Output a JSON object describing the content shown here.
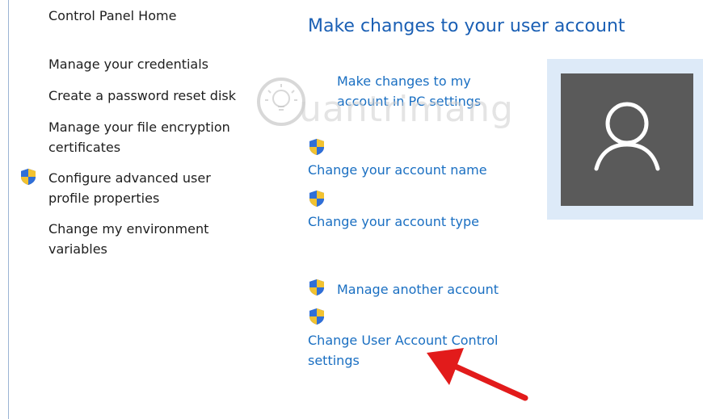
{
  "left_panel": {
    "home": "Control Panel Home",
    "tasks": [
      "Manage your credentials",
      "Create a password reset disk",
      "Manage your file encryption certificates",
      "Configure advanced user profile properties",
      "Change my environment variables"
    ]
  },
  "main": {
    "title": "Make changes to your user account",
    "pc_settings_link": "Make changes to my account in PC settings",
    "links": {
      "change_name": "Change your account name",
      "change_type": "Change your account type",
      "manage_another": "Manage another account",
      "uac": "Change User Account Control settings"
    }
  },
  "watermark": {
    "text": "uantrimang"
  },
  "colors": {
    "link": "#1a6fc2",
    "title": "#1a5fb4",
    "arrow": "#e21b1b",
    "avatar_bg": "#5a5a5a"
  }
}
